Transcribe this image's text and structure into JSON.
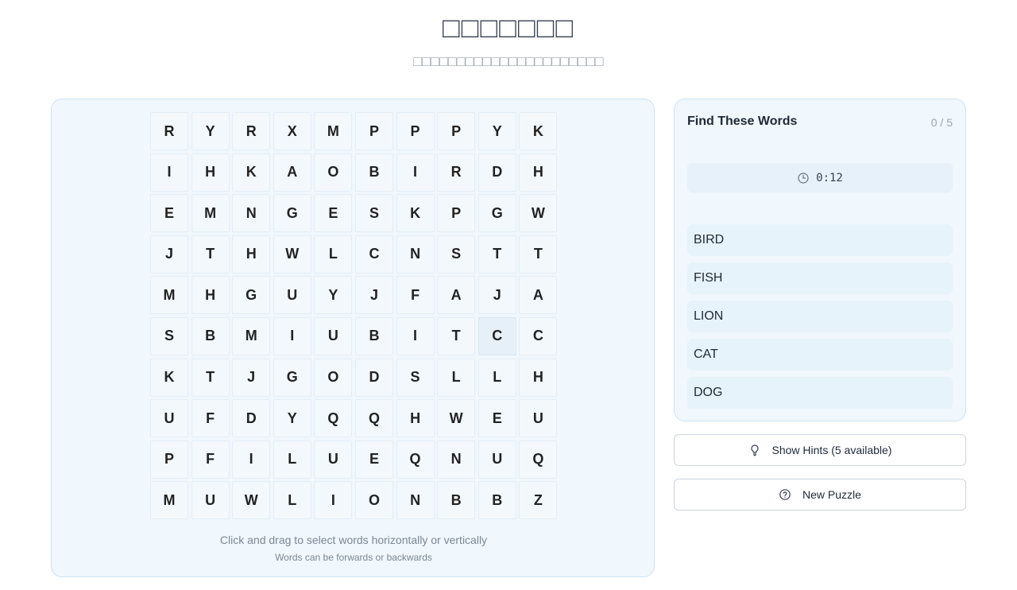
{
  "header": {
    "title": "□□□□□□□",
    "subtitle": "□□□□□□□□□□□□□□□□□□□□□□"
  },
  "grid": {
    "rows": [
      [
        "R",
        "Y",
        "R",
        "X",
        "M",
        "P",
        "P",
        "P",
        "Y",
        "K"
      ],
      [
        "I",
        "H",
        "K",
        "A",
        "O",
        "B",
        "I",
        "R",
        "D",
        "H"
      ],
      [
        "E",
        "M",
        "N",
        "G",
        "E",
        "S",
        "K",
        "P",
        "G",
        "W"
      ],
      [
        "J",
        "T",
        "H",
        "W",
        "L",
        "C",
        "N",
        "S",
        "T",
        "T"
      ],
      [
        "M",
        "H",
        "G",
        "U",
        "Y",
        "J",
        "F",
        "A",
        "J",
        "A"
      ],
      [
        "S",
        "B",
        "M",
        "I",
        "U",
        "B",
        "I",
        "T",
        "C",
        "C"
      ],
      [
        "K",
        "T",
        "J",
        "G",
        "O",
        "D",
        "S",
        "L",
        "L",
        "H"
      ],
      [
        "U",
        "F",
        "D",
        "Y",
        "Q",
        "Q",
        "H",
        "W",
        "E",
        "U"
      ],
      [
        "P",
        "F",
        "I",
        "L",
        "U",
        "E",
        "Q",
        "N",
        "U",
        "Q"
      ],
      [
        "M",
        "U",
        "W",
        "L",
        "I",
        "O",
        "N",
        "B",
        "B",
        "Z"
      ]
    ],
    "highlighted_cell": {
      "row": 6,
      "col": 9
    }
  },
  "instructions": {
    "primary": "Click and drag to select words horizontally or vertically",
    "secondary": "Words can be forwards or backwards"
  },
  "words_panel": {
    "title": "Find These Words",
    "count": "0 / 5",
    "timer": "0:12",
    "timer_icon": "clock-icon",
    "words": [
      "BIRD",
      "FISH",
      "LION",
      "CAT",
      "DOG"
    ]
  },
  "buttons": {
    "hints_label": "Show Hints (5 available)",
    "hints_icon": "lightbulb-icon",
    "new_label": "New Puzzle",
    "new_icon": "question-circle-icon"
  },
  "colors": {
    "panel_bg": "#f0f7fd",
    "panel_border": "#cfe2f1",
    "cell_bg": "#f3f8fc",
    "highlight_bg": "#e6f0f8"
  }
}
